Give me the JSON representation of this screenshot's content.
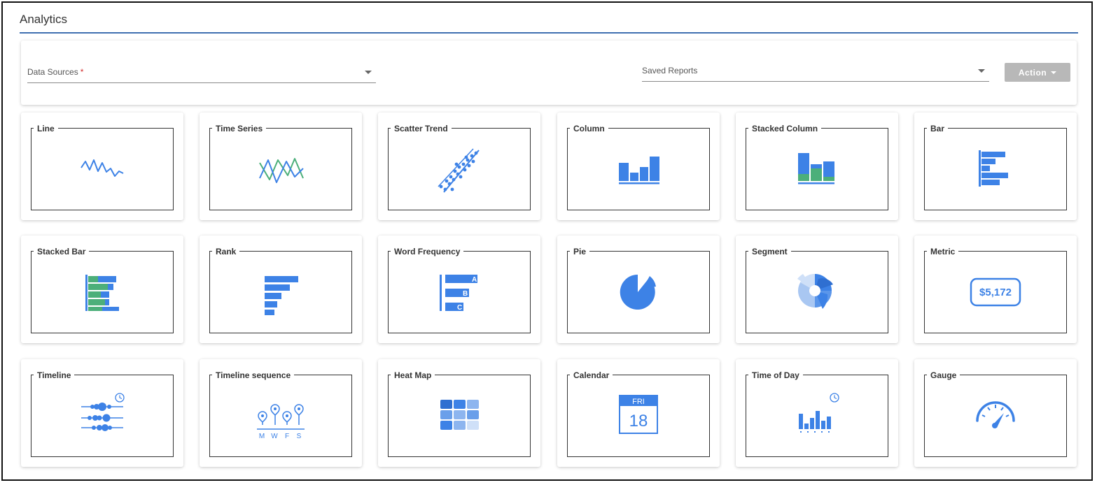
{
  "header": {
    "title": "Analytics"
  },
  "filters": {
    "data_sources": {
      "label": "Data Sources",
      "required_mark": "*"
    },
    "saved_reports": {
      "label": "Saved Reports"
    },
    "action_label": "Action"
  },
  "colors": {
    "accent": "#3f6fb0",
    "chart_blue": "#3d82e6",
    "chart_green": "#4caf7a",
    "button_gray": "#b8b8b8"
  },
  "tiles": [
    {
      "label": "Line",
      "icon": "line-chart-icon"
    },
    {
      "label": "Time Series",
      "icon": "time-series-chart-icon"
    },
    {
      "label": "Scatter Trend",
      "icon": "scatter-trend-chart-icon"
    },
    {
      "label": "Column",
      "icon": "column-chart-icon"
    },
    {
      "label": "Stacked Column",
      "icon": "stacked-column-chart-icon"
    },
    {
      "label": "Bar",
      "icon": "bar-chart-icon"
    },
    {
      "label": "Stacked Bar",
      "icon": "stacked-bar-chart-icon"
    },
    {
      "label": "Rank",
      "icon": "rank-chart-icon"
    },
    {
      "label": "Word Frequency",
      "icon": "word-frequency-chart-icon",
      "letters": [
        "A",
        "B",
        "C"
      ]
    },
    {
      "label": "Pie",
      "icon": "pie-chart-icon"
    },
    {
      "label": "Segment",
      "icon": "segment-chart-icon"
    },
    {
      "label": "Metric",
      "icon": "metric-icon",
      "value": "$5,172"
    },
    {
      "label": "Timeline",
      "icon": "timeline-icon"
    },
    {
      "label": "Timeline sequence",
      "icon": "timeline-sequence-icon",
      "days": [
        "M",
        "W",
        "F",
        "S"
      ]
    },
    {
      "label": "Heat Map",
      "icon": "heat-map-icon"
    },
    {
      "label": "Calendar",
      "icon": "calendar-icon",
      "day": "FRI",
      "date": "18"
    },
    {
      "label": "Time of Day",
      "icon": "time-of-day-icon"
    },
    {
      "label": "Gauge",
      "icon": "gauge-icon"
    }
  ]
}
